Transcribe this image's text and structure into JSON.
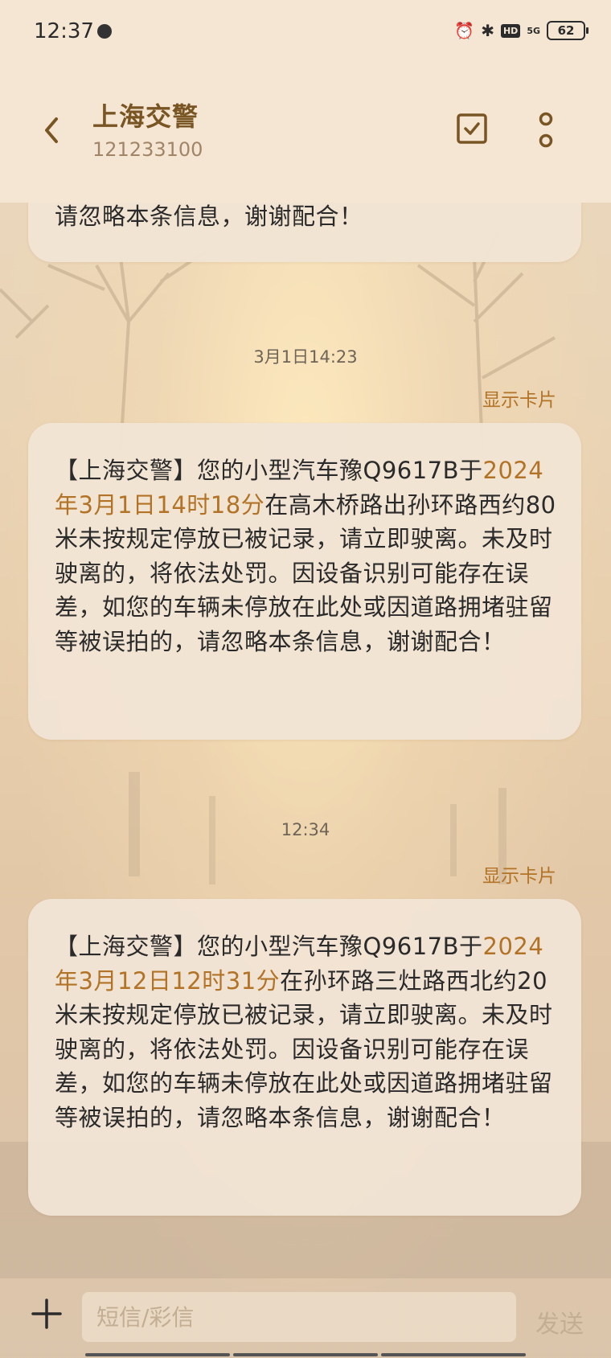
{
  "status_bar": {
    "time": "12:37",
    "icons": [
      "globe-icon",
      "alarm-icon",
      "bluetooth-icon",
      "hd-icon",
      "5g-signal-icon"
    ],
    "hd_label": "HD",
    "network": "5G",
    "battery": "62"
  },
  "header": {
    "contact_name": "上海交警",
    "contact_number": "121233100"
  },
  "thread": {
    "partial_message_tail": "请忽略本条信息，谢谢配合！",
    "show_card_label": "显示卡片",
    "messages": [
      {
        "timestamp": "3月1日14:23",
        "text_prefix": "【上海交警】您的小型汽车豫Q9617B于",
        "highlight": "2024年3月1日14时18分",
        "text_suffix": "在高木桥路出孙环路西约80米未按规定停放已被记录，请立即驶离。未及时驶离的，将依法处罚。因设备识别可能存在误差，如您的车辆未停放在此处或因道路拥堵驻留等被误拍的，请忽略本条信息，谢谢配合！"
      },
      {
        "timestamp": "12:34",
        "text_prefix": "【上海交警】您的小型汽车豫Q9617B于",
        "highlight": "2024年3月12日12时31分",
        "text_suffix": "在孙环路三灶路西北约20米未按规定停放已被记录，请立即驶离。未及时驶离的，将依法处罚。因设备识别可能存在误差，如您的车辆未停放在此处或因道路拥堵驻留等被误拍的，请忽略本条信息，谢谢配合！"
      }
    ]
  },
  "composer": {
    "placeholder": "短信/彩信",
    "send_label": "发送"
  },
  "colors": {
    "accent": "#b27326",
    "title": "#7a5524"
  }
}
